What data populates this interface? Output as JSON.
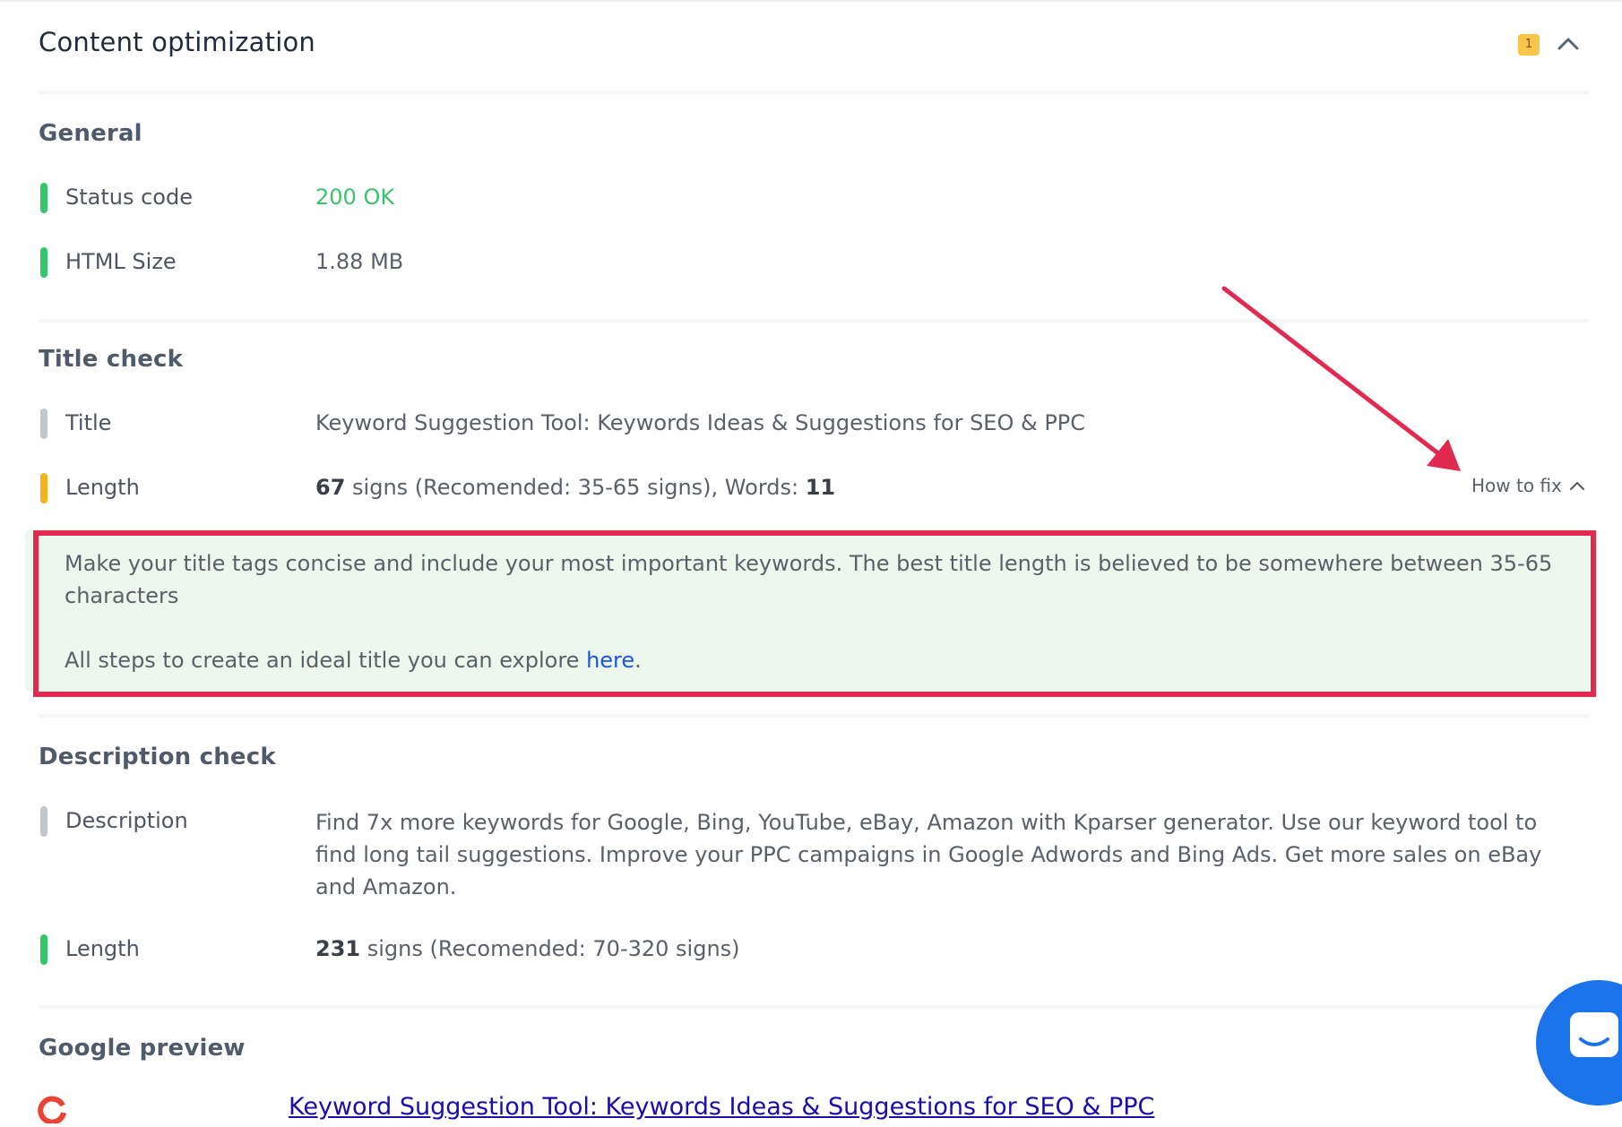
{
  "panel": {
    "title": "Content optimization",
    "badge_count": "1",
    "accent_badge_color": "#f9c64a"
  },
  "general": {
    "title": "General",
    "rows": [
      {
        "label": "Status code",
        "value": "200 OK",
        "status": "green"
      },
      {
        "label": "HTML Size",
        "value": "1.88 MB",
        "status": "green"
      }
    ]
  },
  "title_check": {
    "title": "Title check",
    "title_row": {
      "label": "Title",
      "value": "Keyword Suggestion Tool: Keywords Ideas & Suggestions for SEO & PPC",
      "status": "gray"
    },
    "length_row": {
      "label": "Length",
      "count": "67",
      "middle": " signs (Recomended: 35-65 signs), Words: ",
      "words": "11",
      "status": "yellow"
    },
    "how_to_fix": "How to fix",
    "tip": {
      "line1": "Make your title tags concise and include your most important keywords. The best title length is believed to be somewhere between 35-65 characters",
      "line2_before": "All steps to create an ideal title you can explore ",
      "link": "here",
      "line2_after": "."
    }
  },
  "description_check": {
    "title": "Description check",
    "description_row": {
      "label": "Description",
      "value": "Find 7x more keywords for Google, Bing, YouTube, eBay, Amazon with Kparser generator. Use our keyword tool to find long tail suggestions. Improve your PPC campaigns in Google Adwords and Bing Ads. Get more sales on eBay and Amazon.",
      "status": "gray"
    },
    "length_row": {
      "label": "Length",
      "count": "231",
      "rest": " signs (Recomended: 70-320 signs)",
      "status": "green"
    }
  },
  "google_preview": {
    "title": "Google preview",
    "link_text": "Keyword Suggestion Tool: Keywords Ideas & Suggestions for SEO & PPC"
  },
  "icons": {
    "collapse": "chevron-up-icon",
    "how_to_fix": "chevron-up-icon",
    "annotation": "arrow-icon",
    "chat": "chat-icon",
    "google": "google-logo-icon"
  },
  "colors": {
    "ok_green": "#3cc26a",
    "warning_yellow": "#f6b21b",
    "neutral_gray": "#c2c7cd",
    "highlight_red": "#e02a50",
    "tip_background": "#ecf8ee",
    "chat_blue": "#1a73e8"
  }
}
